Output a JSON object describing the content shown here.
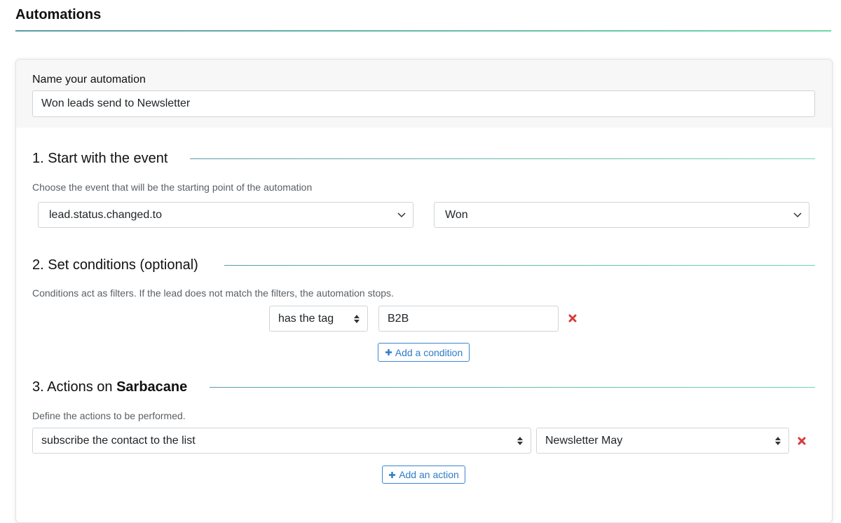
{
  "page": {
    "title": "Automations"
  },
  "name_section": {
    "label": "Name your automation",
    "value": "Won leads send to Newsletter"
  },
  "event_section": {
    "title": "1. Start with the event",
    "help": "Choose the event that will be the starting point of the automation",
    "event_select": "lead.status.changed.to",
    "value_select": "Won"
  },
  "conditions_section": {
    "title": "2. Set conditions (optional)",
    "help": "Conditions act as filters. If the lead does not match the filters, the automation stops.",
    "conditions": [
      {
        "operator": "has the tag",
        "value": "B2B"
      }
    ],
    "add_label": "Add a condition"
  },
  "actions_section": {
    "title_prefix": "3. Actions on",
    "title_app": "Sarbacane",
    "help": "Define the actions to be performed.",
    "actions": [
      {
        "action": "subscribe the contact to the list",
        "target": "Newsletter May"
      }
    ],
    "add_label": "Add an action"
  },
  "colors": {
    "accent_blue": "#2e7bc6",
    "remove_red": "#d63c3c",
    "rule_gradient_start": "#5b9aa8",
    "rule_gradient_end": "#6ed8a8"
  }
}
